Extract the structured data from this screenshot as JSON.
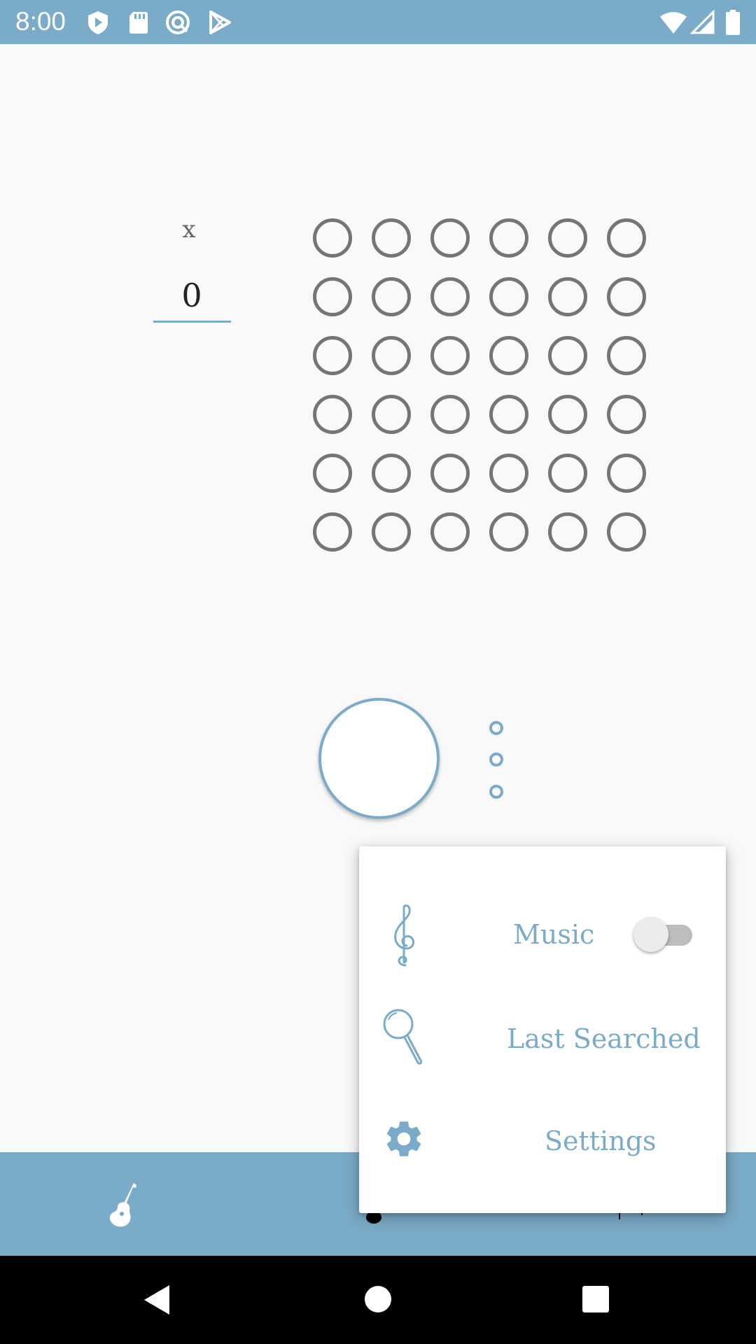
{
  "status_bar": {
    "time": "8:00",
    "left_icons": [
      "shield-play-icon",
      "sd-card-icon",
      "sync-circle-icon",
      "play-store-icon"
    ],
    "right_icons": [
      "wifi-icon",
      "signal-icon",
      "battery-icon"
    ]
  },
  "counter": {
    "label": "x",
    "value": "0"
  },
  "grid": {
    "rows": 6,
    "cols": 6
  },
  "menu": {
    "music_label": "Music",
    "music_enabled": false,
    "last_searched_label": "Last Searched",
    "settings_label": "Settings"
  },
  "colors": {
    "accent": "#7aabc8",
    "background": "#f9f9f9",
    "circle_outline": "#757575",
    "nav_bar": "#000000"
  }
}
